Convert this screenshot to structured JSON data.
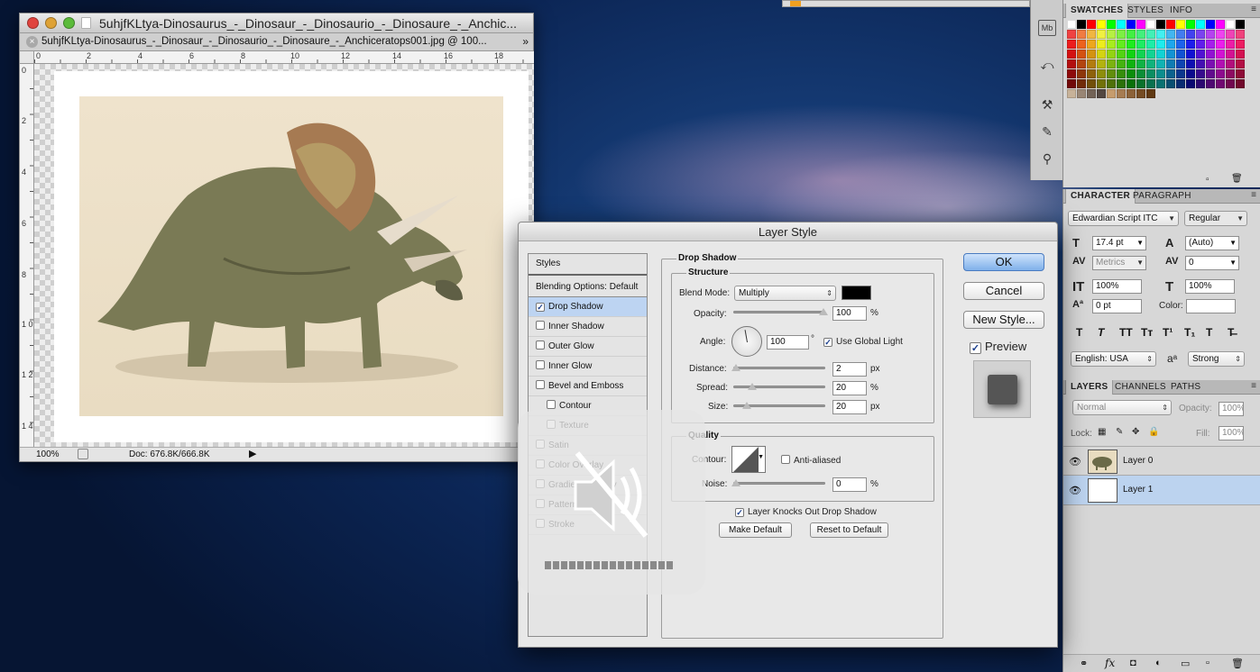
{
  "document_window": {
    "title": "5uhjfKLtya-Dinosaurus_-_Dinosaur_-_Dinosaurio_-_Dinosaure_-_Anchic...",
    "tab_label": "5uhjfKLtya-Dinosaurus_-_Dinosaur_-_Dinosaurio_-_Dinosaure_-_Anchiceratops001.jpg @ 100...",
    "ruler_h": [
      "0",
      "2",
      "4",
      "6",
      "8",
      "10",
      "12",
      "14",
      "16",
      "18"
    ],
    "ruler_v": [
      "0",
      "2",
      "4",
      "6",
      "8",
      "1 0",
      "1 2",
      "1 4"
    ],
    "zoom": "100%",
    "doc_size": "Doc: 676.8K/666.8K"
  },
  "swatches_panel": {
    "tabs": [
      "SWATCHES",
      "STYLES",
      "INFO"
    ],
    "colors": [
      "#ffffff",
      "#000000",
      "#ff0000",
      "#ffff00",
      "#00ff00",
      "#00ffff",
      "#0000ff",
      "#ff00ff",
      "#f26c4f",
      "#f68e55",
      "#fbaf5c",
      "#fff467",
      "#acd372",
      "#7cc576",
      "#3bb878",
      "#1abbb4",
      "#00bff3",
      "#438ccb",
      "#5574b9",
      "#605ca8",
      "#855fa8",
      "#a763a8",
      "#f06ea9",
      "#f26d7d"
    ]
  },
  "character_panel": {
    "tabs": [
      "CHARACTER",
      "PARAGRAPH"
    ],
    "font_family": "Edwardian Script ITC",
    "font_style": "Regular",
    "font_size": "17.4 pt",
    "leading": "(Auto)",
    "kerning": "Metrics",
    "tracking": "0",
    "vscale": "100%",
    "hscale": "100%",
    "baseline": "0 pt",
    "color_label": "Color:",
    "language": "English: USA",
    "aa_icon": "aᵃ",
    "antialias": "Strong",
    "type_buttons": [
      "T",
      "T",
      "TT",
      "Tт",
      "T¹",
      "T₁",
      "T",
      "T̶"
    ]
  },
  "layers_panel": {
    "tabs": [
      "LAYERS",
      "CHANNELS",
      "PATHS"
    ],
    "blend_mode": "Normal",
    "opacity_label": "Opacity:",
    "opacity": "100%",
    "lock_label": "Lock:",
    "fill_label": "Fill:",
    "fill": "100%",
    "layers": [
      {
        "name": "Layer 0",
        "selected": false
      },
      {
        "name": "Layer 1",
        "selected": true
      }
    ]
  },
  "layer_style_dialog": {
    "title": "Layer Style",
    "styles_header": "Styles",
    "blending_options": "Blending Options: Default",
    "style_items": [
      {
        "label": "Drop Shadow",
        "checked": true,
        "selected": true,
        "indent": false
      },
      {
        "label": "Inner Shadow",
        "checked": false,
        "selected": false,
        "indent": false
      },
      {
        "label": "Outer Glow",
        "checked": false,
        "selected": false,
        "indent": false
      },
      {
        "label": "Inner Glow",
        "checked": false,
        "selected": false,
        "indent": false
      },
      {
        "label": "Bevel and Emboss",
        "checked": false,
        "selected": false,
        "indent": false
      },
      {
        "label": "Contour",
        "checked": false,
        "selected": false,
        "indent": true
      },
      {
        "label": "Texture",
        "checked": false,
        "selected": false,
        "indent": true
      },
      {
        "label": "Satin",
        "checked": false,
        "selected": false,
        "indent": false
      },
      {
        "label": "Color Overlay",
        "checked": false,
        "selected": false,
        "indent": false
      },
      {
        "label": "Gradient Overlay",
        "checked": false,
        "selected": false,
        "indent": false
      },
      {
        "label": "Pattern Overlay",
        "checked": false,
        "selected": false,
        "indent": false
      },
      {
        "label": "Stroke",
        "checked": false,
        "selected": false,
        "indent": false
      }
    ],
    "section_title": "Drop Shadow",
    "structure_label": "Structure",
    "blend_mode_label": "Blend Mode:",
    "blend_mode": "Multiply",
    "opacity_label": "Opacity:",
    "opacity": "100",
    "angle_label": "Angle:",
    "angle": "100",
    "degree": "°",
    "use_global_light": "Use Global Light",
    "distance_label": "Distance:",
    "distance": "2",
    "spread_label": "Spread:",
    "spread": "20",
    "size_label": "Size:",
    "size": "20",
    "unit_px": "px",
    "unit_pct": "%",
    "quality_label": "Quality",
    "contour_label": "Contour:",
    "anti_aliased": "Anti-aliased",
    "noise_label": "Noise:",
    "noise": "0",
    "knocks_out": "Layer Knocks Out Drop Shadow",
    "make_default": "Make Default",
    "reset_default": "Reset to Default",
    "ok": "OK",
    "cancel": "Cancel",
    "new_style": "New Style...",
    "preview": "Preview",
    "shadow_color": "#000000"
  }
}
